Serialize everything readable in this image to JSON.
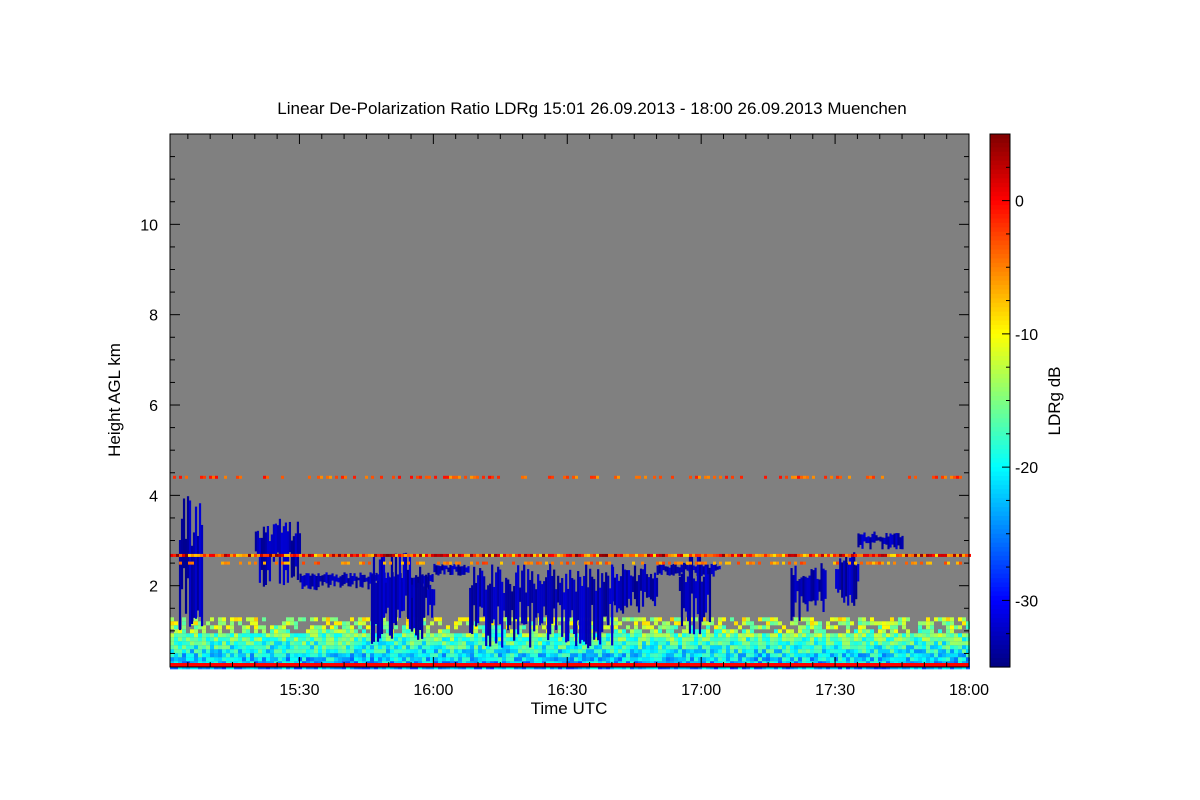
{
  "chart_data": {
    "type": "heatmap",
    "title": "Linear De-Polarization Ratio LDRg   15:01 26.09.2013 - 18:00 26.09.2013 Muenchen",
    "xlabel": "Time UTC",
    "ylabel": "Height AGL km",
    "colorbar_label": "LDRg dB",
    "x_ticks": [
      "15:30",
      "16:00",
      "16:30",
      "17:00",
      "17:30",
      "18:00"
    ],
    "x_tick_values_min": [
      30,
      60,
      90,
      120,
      150,
      180
    ],
    "xlim_min": [
      1,
      180
    ],
    "y_ticks": [
      "2",
      "4",
      "6",
      "8",
      "10"
    ],
    "y_tick_values": [
      2,
      4,
      6,
      8,
      10
    ],
    "ylim": [
      0.2,
      12.0
    ],
    "colorbar_ticks": [
      "0",
      "-10",
      "-20",
      "-30"
    ],
    "colorbar_tick_values": [
      0,
      -10,
      -20,
      -30
    ],
    "colorbar_range": [
      -35,
      5
    ],
    "colormap": "jet",
    "background_color": "#808080",
    "grid": false,
    "features": {
      "surface_noise_layer_km": [
        0.2,
        1.3
      ],
      "surface_noise_ldr_db": [
        -25,
        -10
      ],
      "ground_line_ldr_db": 0,
      "level_line_1": {
        "height_km": 2.67,
        "ldr_db": -2,
        "x_min": [
          1,
          180
        ]
      },
      "level_line_2": {
        "height_km": 2.5,
        "ldr_db": -5,
        "x_min": [
          1,
          180
        ]
      },
      "level_line_3": {
        "height_km": 4.4,
        "ldr_db": -3
      },
      "cloud_ldr_db": -33,
      "cloud_segments_min": [
        [
          3,
          8,
          0.8,
          4.0
        ],
        [
          20,
          30,
          1.9,
          3.5
        ],
        [
          30,
          60,
          1.9,
          2.3
        ],
        [
          46,
          55,
          0.6,
          2.8
        ],
        [
          55,
          60,
          0.8,
          2.5
        ],
        [
          60,
          68,
          2.2,
          2.5
        ],
        [
          68,
          100,
          0.6,
          2.5
        ],
        [
          100,
          110,
          1.3,
          2.5
        ],
        [
          110,
          124,
          2.2,
          2.5
        ],
        [
          115,
          122,
          0.9,
          2.7
        ],
        [
          140,
          148,
          1.2,
          2.5
        ],
        [
          150,
          155,
          1.5,
          2.8
        ],
        [
          155,
          165,
          2.8,
          3.2
        ]
      ]
    }
  }
}
